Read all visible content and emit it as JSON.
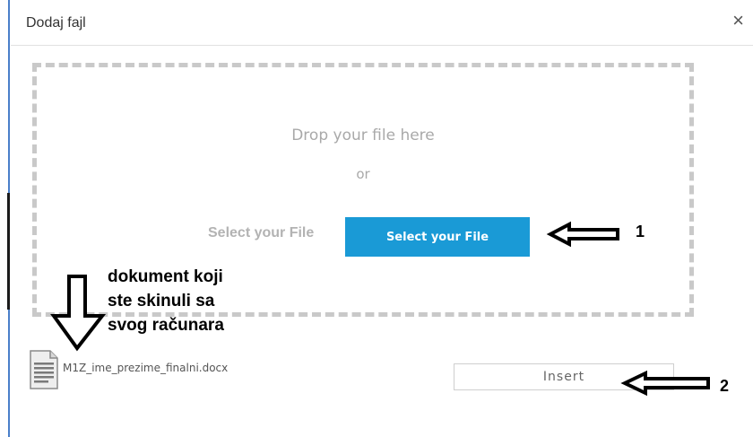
{
  "dialog": {
    "title": "Dodaj fajl",
    "close_label": "×"
  },
  "dropzone": {
    "drop_text": "Drop your file here",
    "or_text": "or",
    "select_label": "Select your File",
    "select_button": "Select your File"
  },
  "file": {
    "name": "M1Z_ime_prezime_finalni.docx",
    "icon": "document-icon"
  },
  "insert_button": "Insert",
  "annotations": {
    "number1": "1",
    "number2": "2",
    "note_line1": "dokument koji",
    "note_line2": "ste skinuli sa",
    "note_line3": "svog računara"
  },
  "colors": {
    "primary_button": "#1a9ad6",
    "dashed_border": "#c9c9c9",
    "window_edge": "#4a7fc9"
  }
}
